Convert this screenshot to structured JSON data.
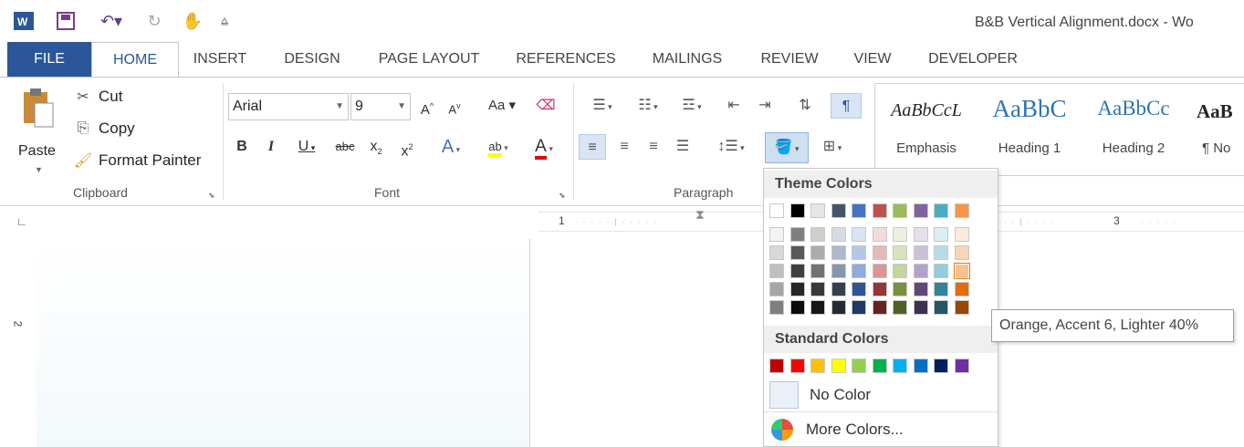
{
  "titlebar": {
    "title": "B&B Vertical Alignment.docx - Wo",
    "quick_access": [
      "word-logo-icon",
      "save-icon",
      "undo-icon",
      "redo-icon",
      "touch-mode-icon",
      "customize-icon"
    ]
  },
  "tabs": [
    "FILE",
    "HOME",
    "INSERT",
    "DESIGN",
    "PAGE LAYOUT",
    "REFERENCES",
    "MAILINGS",
    "REVIEW",
    "VIEW",
    "DEVELOPER"
  ],
  "clipboard": {
    "paste": "Paste",
    "cut": "Cut",
    "copy": "Copy",
    "format_painter": "Format Painter",
    "group_label": "Clipboard"
  },
  "font": {
    "name": "Arial",
    "size": "9",
    "case_label": "Aa",
    "group_label": "Font"
  },
  "paragraph": {
    "group_label": "Paragraph"
  },
  "styles": [
    {
      "sample": "AaBbCcL",
      "name": "Emphasis"
    },
    {
      "sample": "AaBbC",
      "name": "Heading 1"
    },
    {
      "sample": "AaBbCc",
      "name": "Heading 2"
    },
    {
      "sample": "AaB",
      "name": "¶ No"
    }
  ],
  "ruler": {
    "mark_1": "1",
    "mark_3": "3",
    "vmark_2": "2"
  },
  "shading_menu": {
    "theme_header": "Theme Colors",
    "standard_header": "Standard Colors",
    "no_color": "No Color",
    "more_colors": "More Colors...",
    "theme_top_row": [
      "#ffffff",
      "#000000",
      "#e7e6e6",
      "#44546a",
      "#4472c4",
      "#c0504d",
      "#9bbb59",
      "#8064a2",
      "#4bacc6",
      "#f79646"
    ],
    "theme_shades": [
      [
        "#f2f2f2",
        "#7f7f7f",
        "#d0cec9",
        "#d5dce4",
        "#dae3f3",
        "#f2dcdb",
        "#ebf1dd",
        "#e5e0ec",
        "#dbeef3",
        "#fdeada"
      ],
      [
        "#d8d8d8",
        "#595959",
        "#aeaaaa",
        "#acb9ca",
        "#b4c7e7",
        "#e5b9b7",
        "#d7e3bc",
        "#ccc1d9",
        "#b7dde8",
        "#fbd5b5"
      ],
      [
        "#bfbfbf",
        "#3f3f3f",
        "#757171",
        "#8496b0",
        "#8faadc",
        "#d99694",
        "#c3d69b",
        "#b2a2c7",
        "#92cddc",
        "#fac08f"
      ],
      [
        "#a5a5a5",
        "#262626",
        "#3a3838",
        "#323f4f",
        "#2f5496",
        "#953734",
        "#76923c",
        "#5f497a",
        "#31859b",
        "#e36c09"
      ],
      [
        "#7f7f7f",
        "#0c0c0c",
        "#171616",
        "#222a35",
        "#1f3864",
        "#632423",
        "#4f6128",
        "#3f3151",
        "#205867",
        "#974806"
      ]
    ],
    "standard": [
      "#c00000",
      "#ff0000",
      "#ffc000",
      "#ffff00",
      "#92d050",
      "#00b050",
      "#00b0f0",
      "#0070c0",
      "#002060",
      "#7030a0"
    ]
  },
  "tooltip": "Orange, Accent 6, Lighter 40%"
}
